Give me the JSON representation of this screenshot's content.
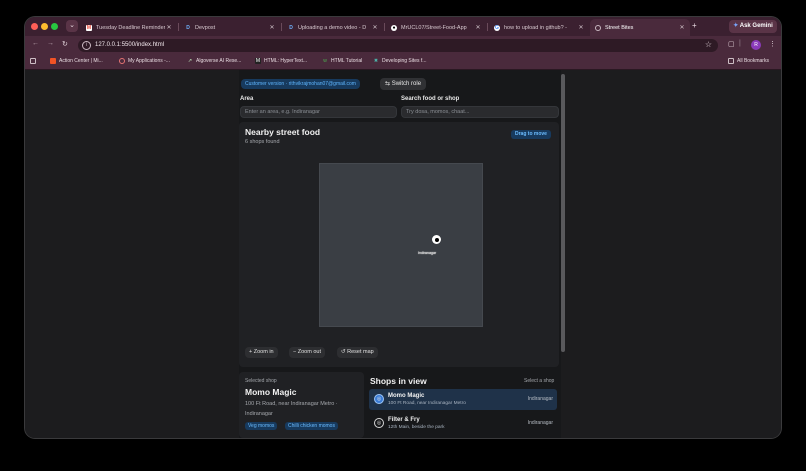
{
  "browser": {
    "tabs": [
      {
        "title": "Tuesday Deadline Reminder:",
        "favicon": "gmail-icon",
        "active": false
      },
      {
        "title": "Devpost",
        "favicon": "devpost-icon",
        "active": false
      },
      {
        "title": "Uploading a demo video - D",
        "favicon": "devpost-icon",
        "active": false
      },
      {
        "title": "MrUCL07/Street-Food-App",
        "favicon": "github-icon",
        "active": false
      },
      {
        "title": "how to upload in github? -",
        "favicon": "google-icon",
        "active": false
      },
      {
        "title": "Street Bites",
        "favicon": "globe-icon",
        "active": true
      }
    ],
    "new_tab": "+",
    "ask_gemini": "Ask Gemini",
    "url": "127.0.0.1:5500/index.html",
    "profile_initial": "R",
    "bookmarks": [
      "Action Center | Mi...",
      "My Applications -...",
      "Algoverse AI Rese...",
      "HTML: HyperText...",
      "HTML Tutorial",
      "Developing Sites f..."
    ],
    "all_bookmarks": "All Bookmarks"
  },
  "header": {
    "user_pill": "Customer version · rithvikrajmohan07@gmail.com",
    "switch_role": "Switch role"
  },
  "filters": {
    "area_label": "Area",
    "area_placeholder": "Enter an area, e.g. Indiranagar",
    "search_label": "Search food or shop",
    "search_placeholder": "Try dosa, momos, chaat..."
  },
  "nearby": {
    "title": "Nearby street food",
    "count": "6 shops found",
    "drag_hint": "Drag to move",
    "marker_label": "Indiranagar",
    "zoom_in": "Zoom in",
    "zoom_out": "Zoom out",
    "reset": "Reset map"
  },
  "selected": {
    "caption": "Selected shop",
    "name": "Momo Magic",
    "address": "100 Ft Road, near Indiranagar Metro · Indiranagar",
    "tags": [
      "Veg momos",
      "Chilli chicken momos"
    ]
  },
  "shops_in_view": {
    "title": "Shops in view",
    "hint": "Select a shop",
    "items": [
      {
        "name": "Momo Magic",
        "address": "100 Ft Road, near Indiranagar Metro",
        "area": "Indiranagar",
        "active": true
      },
      {
        "name": "Filter & Fry",
        "address": "12th Main, beside the park",
        "area": "Indiranagar",
        "active": false
      }
    ]
  },
  "colors": {
    "accent": "#5fb6ff",
    "pill_bg": "#173a5e",
    "frame": "#4a2a3c",
    "app_bg": "#17181a"
  }
}
